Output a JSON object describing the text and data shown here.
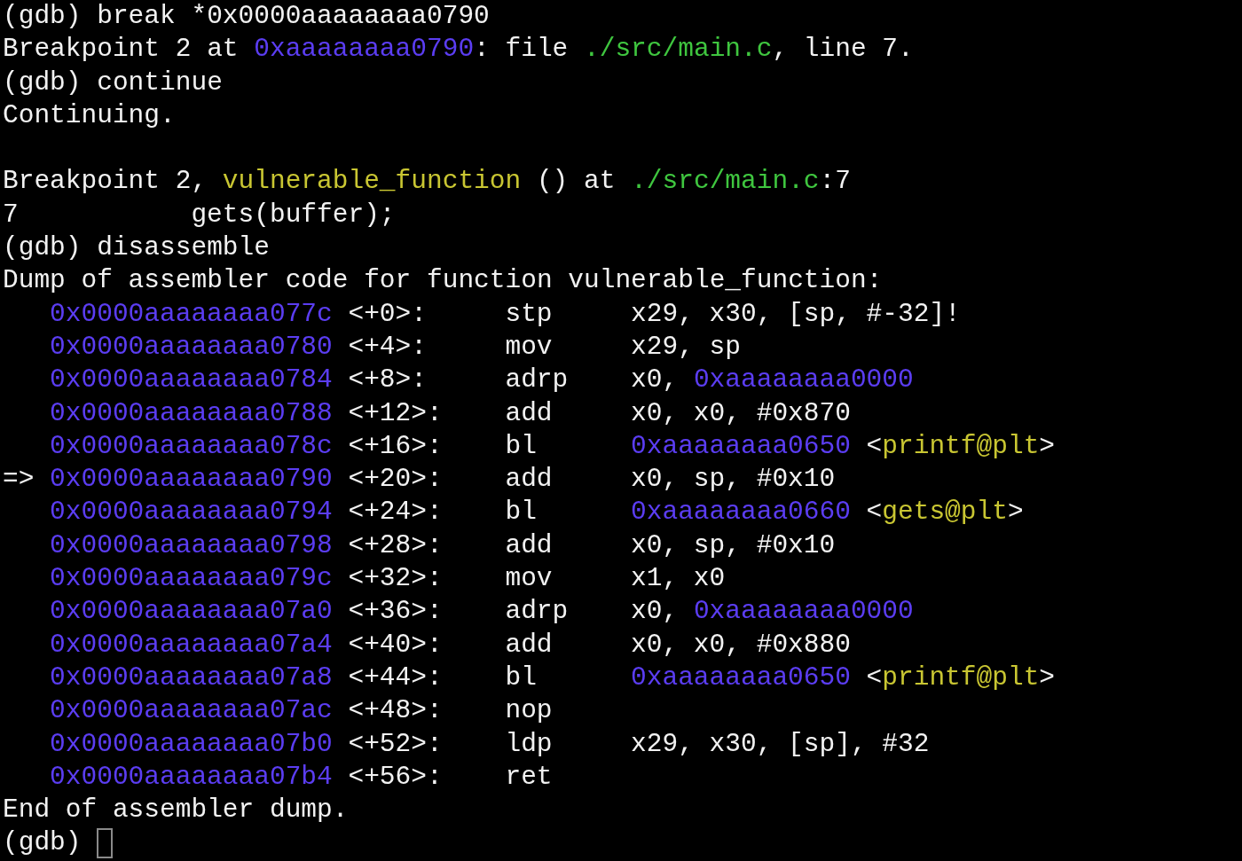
{
  "lines": [
    {
      "kind": "text",
      "segments": [
        {
          "kind": "plain",
          "text": "(gdb) break *0x0000aaaaaaaa0790"
        }
      ]
    },
    {
      "kind": "text",
      "segments": [
        {
          "kind": "plain",
          "text": "Breakpoint 2 at "
        },
        {
          "kind": "address",
          "text": "0xaaaaaaaa0790"
        },
        {
          "kind": "plain",
          "text": ": file "
        },
        {
          "kind": "file",
          "text": "./src/main.c"
        },
        {
          "kind": "plain",
          "text": ", line 7."
        }
      ]
    },
    {
      "kind": "text",
      "segments": [
        {
          "kind": "plain",
          "text": "(gdb) continue"
        }
      ]
    },
    {
      "kind": "text",
      "segments": [
        {
          "kind": "plain",
          "text": "Continuing."
        }
      ]
    },
    {
      "kind": "blank"
    },
    {
      "kind": "text",
      "segments": [
        {
          "kind": "plain",
          "text": "Breakpoint 2, "
        },
        {
          "kind": "function",
          "text": "vulnerable_function"
        },
        {
          "kind": "plain",
          "text": " () at "
        },
        {
          "kind": "file",
          "text": "./src/main.c"
        },
        {
          "kind": "plain",
          "text": ":7"
        }
      ]
    },
    {
      "kind": "source",
      "number": "7",
      "code": "gets(buffer);"
    },
    {
      "kind": "text",
      "segments": [
        {
          "kind": "plain",
          "text": "(gdb) disassemble"
        }
      ]
    },
    {
      "kind": "text",
      "segments": [
        {
          "kind": "plain",
          "text": "Dump of assembler code for function vulnerable_function:"
        }
      ]
    },
    {
      "kind": "asm",
      "address": "0x0000aaaaaaaa077c",
      "offset": "<+0>:",
      "mnemonic": "stp",
      "operands": [
        {
          "kind": "plain",
          "text": "x29, x30, [sp, #-32]!"
        }
      ]
    },
    {
      "kind": "asm",
      "address": "0x0000aaaaaaaa0780",
      "offset": "<+4>:",
      "mnemonic": "mov",
      "operands": [
        {
          "kind": "plain",
          "text": "x29, sp"
        }
      ]
    },
    {
      "kind": "asm",
      "address": "0x0000aaaaaaaa0784",
      "offset": "<+8>:",
      "mnemonic": "adrp",
      "operands": [
        {
          "kind": "plain",
          "text": "x0, "
        },
        {
          "kind": "address",
          "text": "0xaaaaaaaa0000"
        }
      ]
    },
    {
      "kind": "asm",
      "address": "0x0000aaaaaaaa0788",
      "offset": "<+12>:",
      "mnemonic": "add",
      "operands": [
        {
          "kind": "plain",
          "text": "x0, x0, #0x870"
        }
      ]
    },
    {
      "kind": "asm",
      "address": "0x0000aaaaaaaa078c",
      "offset": "<+16>:",
      "mnemonic": "bl",
      "operands": [
        {
          "kind": "address",
          "text": "0xaaaaaaaa0650"
        },
        {
          "kind": "plain",
          "text": " <"
        },
        {
          "kind": "function",
          "text": "printf@plt"
        },
        {
          "kind": "plain",
          "text": ">"
        }
      ]
    },
    {
      "kind": "asm",
      "marker": "=>",
      "address": "0x0000aaaaaaaa0790",
      "offset": "<+20>:",
      "mnemonic": "add",
      "operands": [
        {
          "kind": "plain",
          "text": "x0, sp, #0x10"
        }
      ]
    },
    {
      "kind": "asm",
      "address": "0x0000aaaaaaaa0794",
      "offset": "<+24>:",
      "mnemonic": "bl",
      "operands": [
        {
          "kind": "address",
          "text": "0xaaaaaaaa0660"
        },
        {
          "kind": "plain",
          "text": " <"
        },
        {
          "kind": "function",
          "text": "gets@plt"
        },
        {
          "kind": "plain",
          "text": ">"
        }
      ]
    },
    {
      "kind": "asm",
      "address": "0x0000aaaaaaaa0798",
      "offset": "<+28>:",
      "mnemonic": "add",
      "operands": [
        {
          "kind": "plain",
          "text": "x0, sp, #0x10"
        }
      ]
    },
    {
      "kind": "asm",
      "address": "0x0000aaaaaaaa079c",
      "offset": "<+32>:",
      "mnemonic": "mov",
      "operands": [
        {
          "kind": "plain",
          "text": "x1, x0"
        }
      ]
    },
    {
      "kind": "asm",
      "address": "0x0000aaaaaaaa07a0",
      "offset": "<+36>:",
      "mnemonic": "adrp",
      "operands": [
        {
          "kind": "plain",
          "text": "x0, "
        },
        {
          "kind": "address",
          "text": "0xaaaaaaaa0000"
        }
      ]
    },
    {
      "kind": "asm",
      "address": "0x0000aaaaaaaa07a4",
      "offset": "<+40>:",
      "mnemonic": "add",
      "operands": [
        {
          "kind": "plain",
          "text": "x0, x0, #0x880"
        }
      ]
    },
    {
      "kind": "asm",
      "address": "0x0000aaaaaaaa07a8",
      "offset": "<+44>:",
      "mnemonic": "bl",
      "operands": [
        {
          "kind": "address",
          "text": "0xaaaaaaaa0650"
        },
        {
          "kind": "plain",
          "text": " <"
        },
        {
          "kind": "function",
          "text": "printf@plt"
        },
        {
          "kind": "plain",
          "text": ">"
        }
      ]
    },
    {
      "kind": "asm",
      "address": "0x0000aaaaaaaa07ac",
      "offset": "<+48>:",
      "mnemonic": "nop"
    },
    {
      "kind": "asm",
      "address": "0x0000aaaaaaaa07b0",
      "offset": "<+52>:",
      "mnemonic": "ldp",
      "operands": [
        {
          "kind": "plain",
          "text": "x29, x30, [sp], #32"
        }
      ]
    },
    {
      "kind": "asm",
      "address": "0x0000aaaaaaaa07b4",
      "offset": "<+56>:",
      "mnemonic": "ret"
    },
    {
      "kind": "text",
      "segments": [
        {
          "kind": "plain",
          "text": "End of assembler dump."
        }
      ]
    },
    {
      "kind": "prompt",
      "segments": [
        {
          "kind": "plain",
          "text": "(gdb) "
        }
      ],
      "cursor": true
    }
  ]
}
